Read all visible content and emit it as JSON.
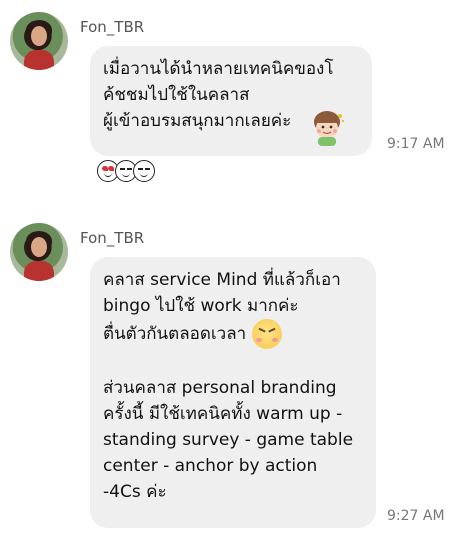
{
  "messages": [
    {
      "sender": "Fon_TBR",
      "lines": [
        "เมื่อวานได้นำหลายเทคนิคของโ",
        "ค้ชชมไปใช้ในคลาส",
        "ผู้เข้าอบรมสนุกมากเลยค่ะ"
      ],
      "sticker": "smiling-girl-sticker",
      "time": "9:17 AM",
      "reactions": [
        "heart-eyes-emoji",
        "smile-emoji",
        "smile-emoji"
      ]
    },
    {
      "sender": "Fon_TBR",
      "lines": [
        "คลาส service Mind ที่แล้วก็เอา",
        "bingo ไปใช้ work มากค่ะ",
        "ตื่นตัวกันตลอดเวลา",
        "",
        "ส่วนคลาส personal branding",
        "ครั้งนี้ มีใช้เทคนิคทั้ง warm up -",
        "standing survey - game table",
        "center - anchor by action",
        "-4Cs ค่ะ"
      ],
      "inline_emoji": "grinning-blush-emoji",
      "time": "9:27 AM"
    }
  ]
}
